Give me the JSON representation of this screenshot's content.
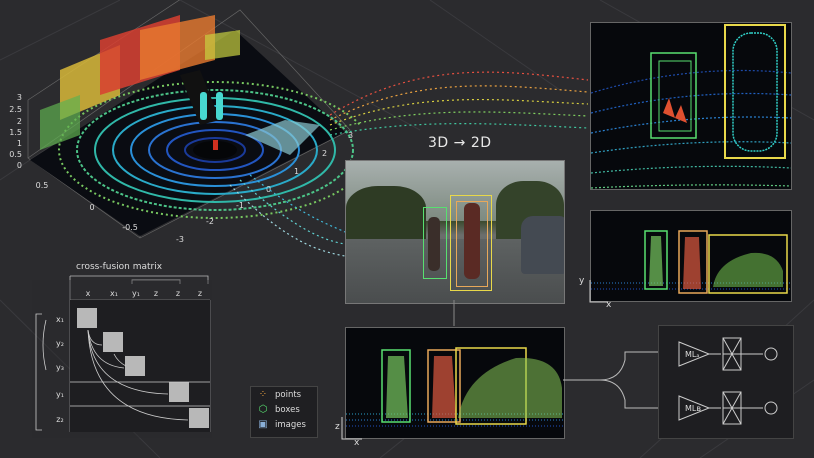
{
  "heading": "3D → 2D",
  "matrix": {
    "title": "cross-fusion matrix",
    "col_labels": [
      "x",
      "x₁",
      "y₁",
      "z",
      "z",
      "z"
    ],
    "row_labels": [
      "x₁",
      "y₂",
      "y₃",
      "y₁",
      "z₂"
    ]
  },
  "legend": {
    "items": [
      {
        "label": "points",
        "icon": "points-icon"
      },
      {
        "label": "boxes",
        "icon": "box-icon"
      },
      {
        "label": "images",
        "icon": "image-icon"
      }
    ]
  },
  "ml": {
    "model_a": "MLₐ",
    "model_b": "MLʙ"
  },
  "axes3d": {
    "z_ticks": [
      "3",
      "2.5",
      "2",
      "1.5",
      "1",
      "0.5",
      "0"
    ],
    "x_ticks": [
      "0.5",
      "0",
      "-0.5"
    ],
    "y_ticks": [
      "3",
      "2",
      "1",
      "0",
      "-1",
      "-2",
      "-3"
    ]
  },
  "axis_labels": {
    "side_y": "y",
    "side_x": "x",
    "front_z": "z",
    "front_x": "x"
  },
  "colors": {
    "box_green": "#58e070",
    "box_yellow": "#e8d84a",
    "box_orange": "#e8a85a"
  }
}
